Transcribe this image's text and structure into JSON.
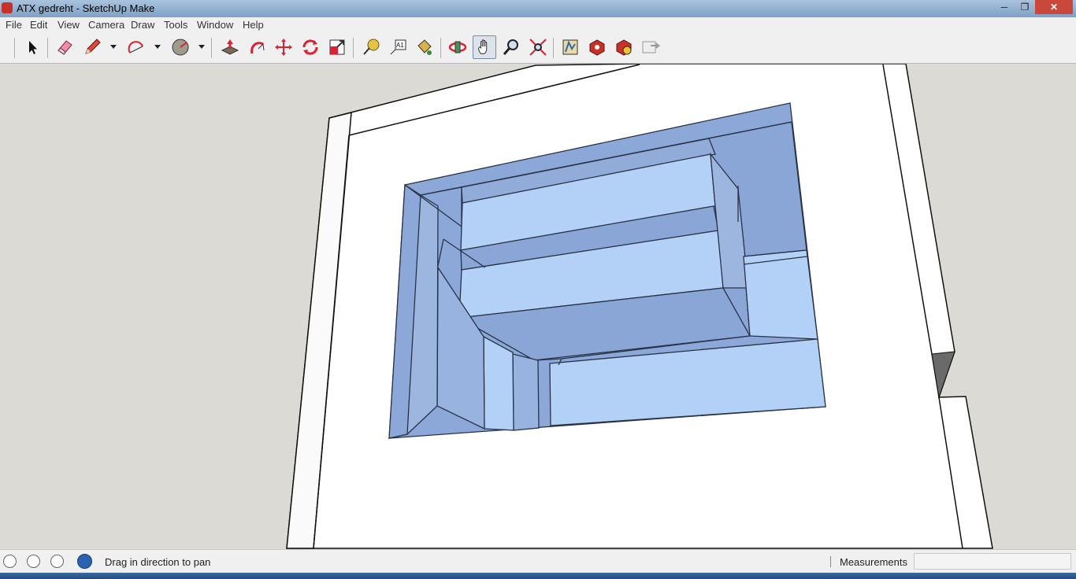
{
  "window": {
    "title": "ATX gedreht - SketchUp Make"
  },
  "menu": [
    "File",
    "Edit",
    "View",
    "Camera",
    "Draw",
    "Tools",
    "Window",
    "Help"
  ],
  "toolbar": {
    "tools": [
      "select",
      "eraser",
      "pencil",
      "arc",
      "circle",
      "push-pull",
      "follow-me",
      "move",
      "rotate",
      "scale",
      "tape-measure",
      "text",
      "paint-bucket",
      "orbit",
      "pan",
      "zoom",
      "zoom-extents",
      "3d-warehouse",
      "get-models",
      "share-model",
      "send-to-layout"
    ],
    "active_tool": "pan"
  },
  "status": {
    "hint": "Drag in direction to pan",
    "measurements_label": "Measurements",
    "measurements_value": ""
  },
  "colors": {
    "face": "#aac4ef",
    "face_shade": "#8ca8d8",
    "edge": "#1f2a3a",
    "background": "#dcdad5"
  }
}
